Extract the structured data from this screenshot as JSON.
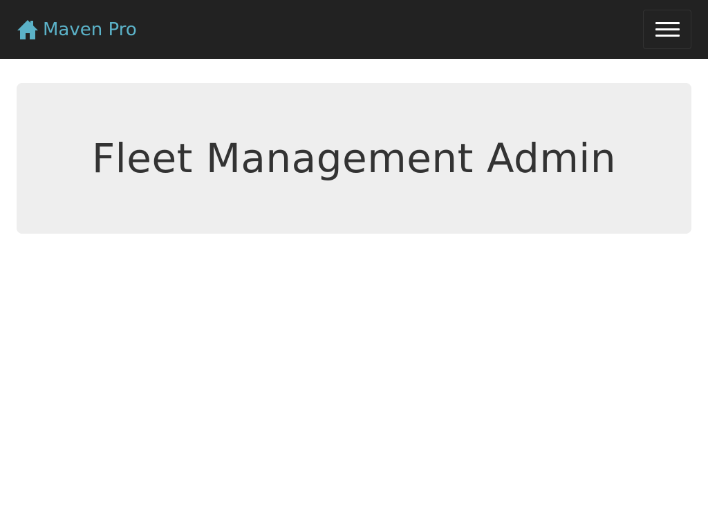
{
  "colors": {
    "navbar_bg": "#222222",
    "brand": "#5bb2c8",
    "jumbotron_bg": "#eeeeee",
    "heading": "#333333"
  },
  "navbar": {
    "brand": {
      "icon": "home-icon",
      "label": "Maven Pro"
    },
    "toggle": {
      "icon": "hamburger-menu-icon"
    }
  },
  "jumbotron": {
    "title": "Fleet Management Admin"
  }
}
